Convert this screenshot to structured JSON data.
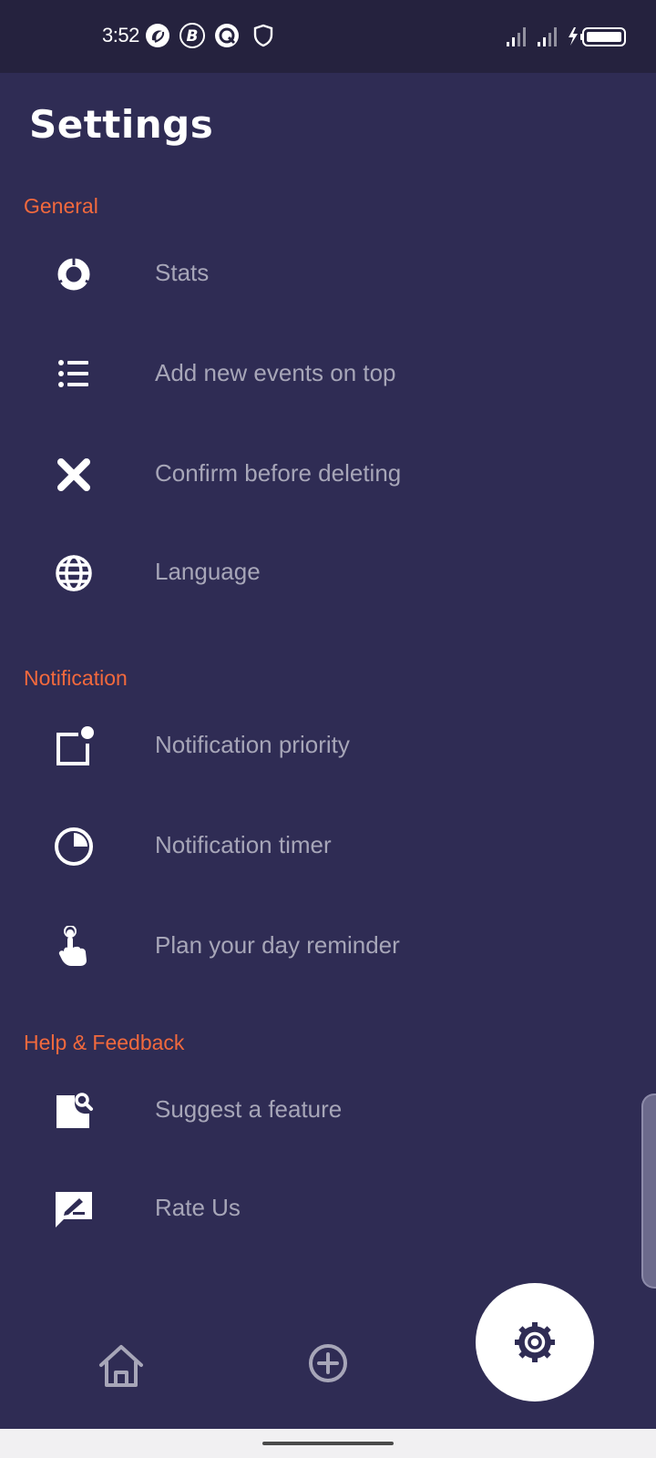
{
  "status_bar": {
    "time": "3:52",
    "app_icons": [
      "swirl-app-icon",
      "b-app-icon",
      "q-app-icon",
      "shield-icon"
    ],
    "right_icons": [
      "signal-icon",
      "signal-icon",
      "charging-icon",
      "battery-icon"
    ]
  },
  "header": {
    "title": "Settings"
  },
  "sections": [
    {
      "title": "General",
      "items": [
        {
          "label": "Stats",
          "icon": "donut-chart-icon"
        },
        {
          "label": "Add new events on top",
          "icon": "list-icon"
        },
        {
          "label": "Confirm before deleting",
          "icon": "close-x-icon"
        },
        {
          "label": "Language",
          "icon": "globe-icon"
        }
      ]
    },
    {
      "title": "Notification",
      "items": [
        {
          "label": "Notification priority",
          "icon": "notification-badge-icon"
        },
        {
          "label": "Notification timer",
          "icon": "timer-pie-icon"
        },
        {
          "label": "Plan your day reminder",
          "icon": "finger-reminder-icon"
        }
      ]
    },
    {
      "title": "Help & Feedback",
      "items": [
        {
          "label": "Suggest a feature",
          "icon": "document-search-icon"
        },
        {
          "label": "Rate Us",
          "icon": "rate-feedback-icon"
        }
      ]
    }
  ],
  "bottom_nav": {
    "items": [
      "home-icon",
      "add-circle-icon"
    ],
    "fab_icon": "gear-icon"
  },
  "colors": {
    "background": "#2f2c54",
    "status_bar": "#25223e",
    "accent": "#f2693d",
    "label": "#a7a6b8"
  }
}
